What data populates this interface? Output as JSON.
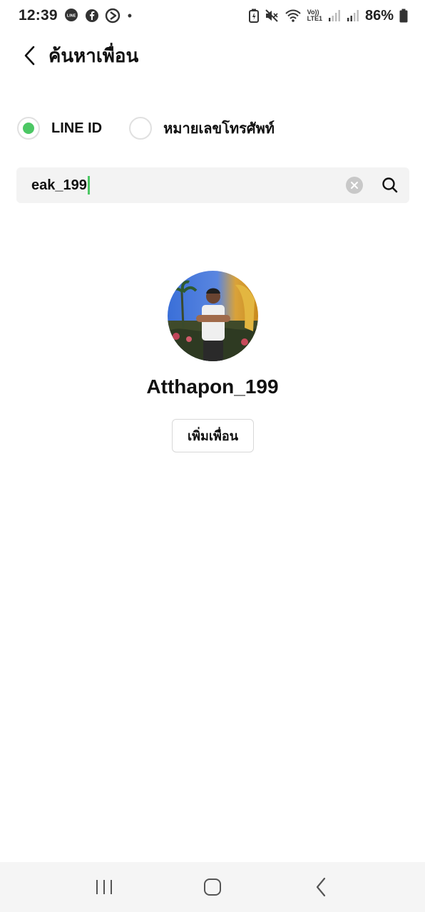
{
  "status_bar": {
    "time": "12:39",
    "notification_icons": [
      "line-icon",
      "facebook-icon",
      "play-icon"
    ],
    "more_dot": "•",
    "volte_top": "Vo))",
    "volte_bottom": "LTE1",
    "battery": "86%"
  },
  "header": {
    "title": "ค้นหาเพื่อน",
    "back_icon": "chevron-left-icon"
  },
  "search_type": {
    "options": [
      {
        "label": "LINE ID",
        "selected": true
      },
      {
        "label": "หมายเลขโทรศัพท์",
        "selected": false
      }
    ]
  },
  "search": {
    "value": "eak_199",
    "clear_icon": "clear-icon",
    "search_icon": "search-icon"
  },
  "result": {
    "name": "Atthapon_199",
    "add_button_label": "เพิ่มเพื่อน"
  },
  "colors": {
    "accent": "#4cc764",
    "search_bg": "#f3f3f3",
    "nav_bg": "#f5f5f5"
  }
}
